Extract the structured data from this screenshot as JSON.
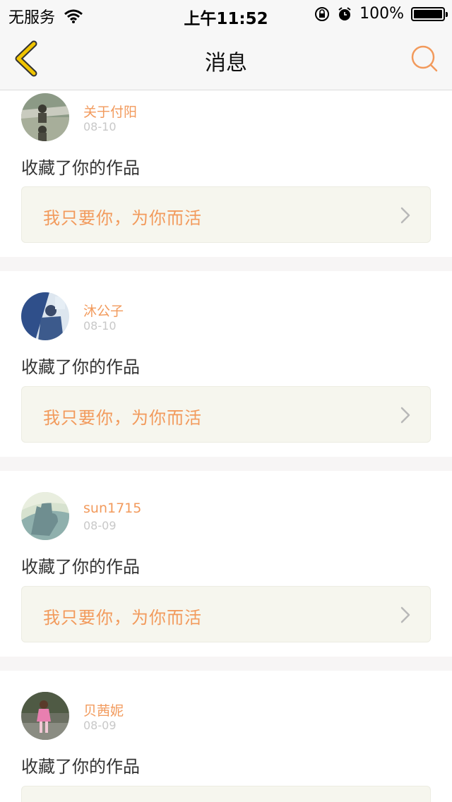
{
  "status_bar": {
    "carrier": "无服务",
    "time": "上午11:52",
    "battery": "100%"
  },
  "nav": {
    "title": "消息"
  },
  "colors": {
    "accent": "#f29a5c",
    "back_icon": "#f0c400",
    "work_box_bg": "#f6f6ee"
  },
  "messages": [
    {
      "username": "关于付阳",
      "date": "08-10",
      "action": "收藏了你的作品",
      "work_title": "我只要你，为你而活"
    },
    {
      "username": "沐公子",
      "date": "08-10",
      "action": "收藏了你的作品",
      "work_title": "我只要你，为你而活"
    },
    {
      "username": "sun1715",
      "date": "08-09",
      "action": "收藏了你的作品",
      "work_title": "我只要你，为你而活"
    },
    {
      "username": "贝茜妮",
      "date": "08-09",
      "action": "收藏了你的作品",
      "work_title": ""
    }
  ]
}
